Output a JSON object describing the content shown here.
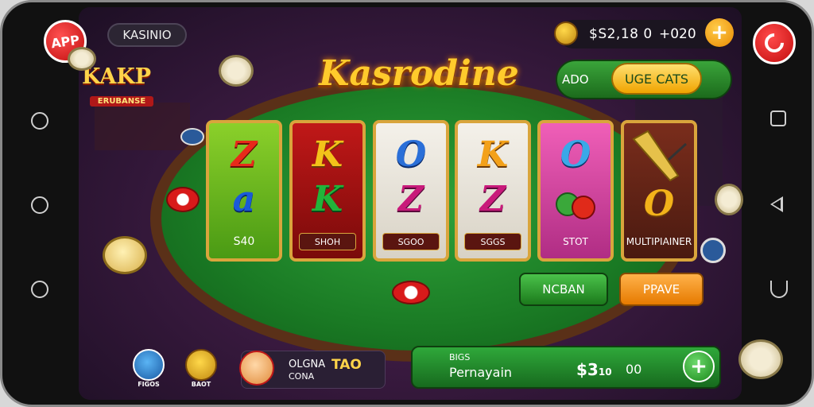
{
  "header": {
    "app_badge": "APP",
    "kasino_label": "KASINIO",
    "coins_value": "$S2,18 0",
    "coins_delta": "+020",
    "add_coins": "+"
  },
  "logo": {
    "title": "Kasrodine",
    "left_logo_title": "KAKP",
    "left_logo_sub": "ERUBANSE"
  },
  "promo": {
    "label": "ADO",
    "button": "UGE CATS"
  },
  "reels": [
    {
      "top": "Z",
      "mid": "a",
      "label": "S40",
      "top_color": "#e82a1a",
      "mid_color": "#1a5ad8"
    },
    {
      "top": "K",
      "mid": "K",
      "label": "SHOH",
      "top_color": "#f3c21a",
      "mid_color": "#22b43a"
    },
    {
      "top": "O",
      "mid": "Z",
      "label": "SGOO",
      "top_color": "#2a6fd8",
      "mid_color": "#c81a7a"
    },
    {
      "top": "K",
      "mid": "Z",
      "label": "SGGS",
      "top_color": "#f3a11a",
      "mid_color": "#c81a7a"
    },
    {
      "top": "O",
      "mid": "",
      "label": "STOT",
      "top_color": "#3aa8e8",
      "mid_color": "#22a43a"
    },
    {
      "top": "",
      "mid": "O",
      "label": "MULTIPIAINER",
      "top_color": "#e6c14a",
      "mid_color": "#f3b21a"
    }
  ],
  "actions": {
    "left": "NCBAN",
    "right": "PPAVE"
  },
  "bottom_bar": {
    "small": "BIGS",
    "main": "Pernayain",
    "amount": "$3",
    "amount_sub": "10",
    "icon_text": "00",
    "plus": "+"
  },
  "player": {
    "name": "OLGNA",
    "tag": "TAO",
    "sub": "CONA"
  },
  "badges": {
    "first": "FIGOS",
    "second": "BAOT"
  }
}
